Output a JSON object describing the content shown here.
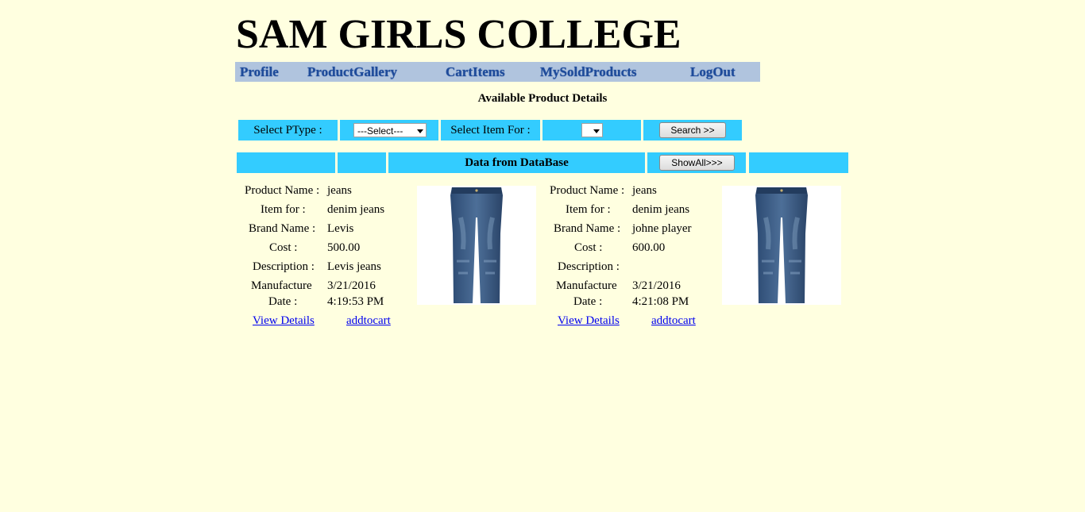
{
  "header": {
    "title": "SAM GIRLS COLLEGE"
  },
  "nav": {
    "items": [
      {
        "label": "Profile"
      },
      {
        "label": "ProductGallery"
      },
      {
        "label": "CartItems"
      },
      {
        "label": "MySoldProducts"
      },
      {
        "label": "LogOut"
      }
    ]
  },
  "section": {
    "heading": "Available Product Details"
  },
  "filters": {
    "ptype_label": "Select PType :",
    "ptype_value": "---Select---",
    "itemfor_label": "Select Item For :",
    "itemfor_value": "",
    "search_button": "Search >>"
  },
  "data_header": {
    "title": "Data from DataBase",
    "showall_button": "ShowAll>>>"
  },
  "labels": {
    "product_name": "Product Name :",
    "item_for": "Item for :",
    "brand_name": "Brand Name :",
    "cost": "Cost :",
    "description": "Description :",
    "manufacture_1": "Manufacture",
    "manufacture_2": "Date :",
    "view_details": "View Details",
    "add_to_cart": "addtocart"
  },
  "products": [
    {
      "name": "jeans",
      "item_for": "denim jeans",
      "brand": "Levis",
      "cost": "500.00",
      "description": "Levis jeans",
      "date": "3/21/2016",
      "time": "4:19:53 PM",
      "image_icon": "jeans-image"
    },
    {
      "name": "jeans",
      "item_for": "denim jeans",
      "brand": "johne player",
      "cost": "600.00",
      "description": "",
      "date": "3/21/2016",
      "time": "4:21:08 PM",
      "image_icon": "jeans-image"
    }
  ],
  "colors": {
    "page_background": "#ffffe0",
    "nav_background": "#b0c4de",
    "nav_text": "#1e4b9a",
    "table_header": "#33ccff",
    "link": "#0000ee"
  }
}
